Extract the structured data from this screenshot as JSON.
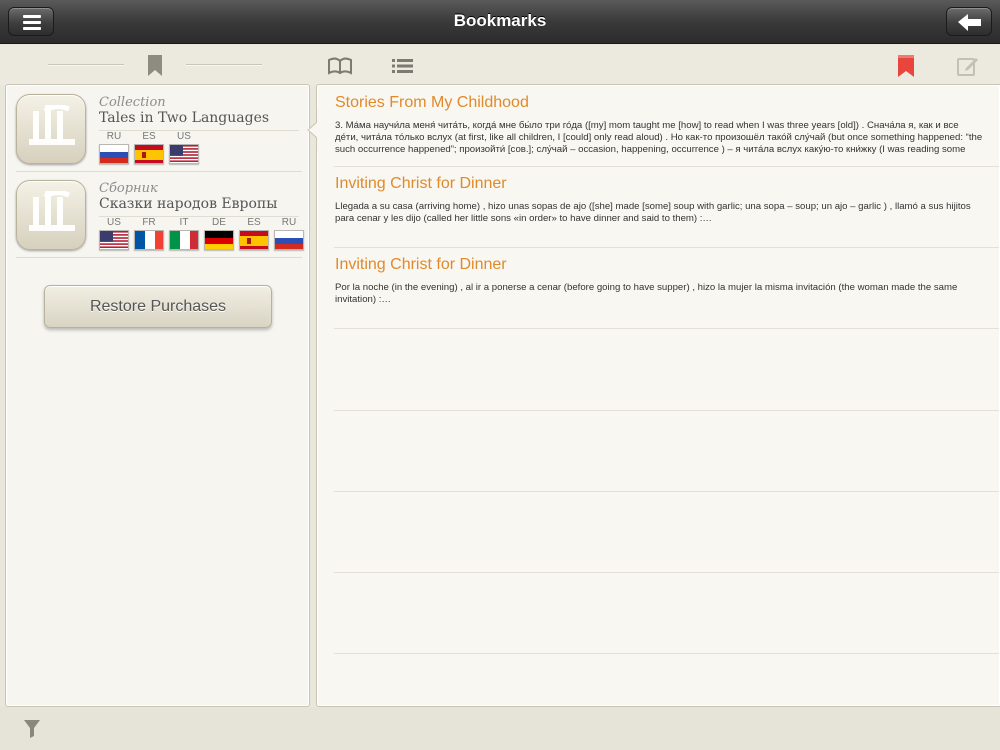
{
  "nav": {
    "title": "Bookmarks",
    "menu_icon": "menu-icon",
    "back_icon": "back-arrow-icon"
  },
  "toolbar": {
    "icons": [
      "bookmark-icon",
      "book-icon",
      "list-icon",
      "red-bookmark-icon",
      "edit-note-icon"
    ],
    "accent_color": "#e8453c"
  },
  "collections": [
    {
      "subtitle": "Collection",
      "title": "Tales in Two Languages",
      "languages": [
        "RU",
        "ES",
        "US"
      ]
    },
    {
      "subtitle": "Сборник",
      "title": "Сказки народов Европы",
      "languages": [
        "US",
        "FR",
        "IT",
        "DE",
        "ES",
        "RU"
      ]
    }
  ],
  "restore_label": "Restore Purchases",
  "bookmarks": [
    {
      "title": "Stories From My Childhood",
      "text": "3. Мáма научи́ла меня́ чита́ть, когда́ мне бы́ло три го́да  ([my] mom taught me [how] to read when I was three years [old]) . Снача́ла я, как и все де́ти, чита́ла то́лько вслух  (at first, like all children, I [could] only read aloud) . Но как-то произошёл тако́й слу́чай  (but once something happened: “the such occurrence happened”;    произойти́ [сов.]; слу́чай – occasion, happening, occurrence )   – я чита́ла вслух каку́ю-то кни́жку  (I was reading some bo…"
    },
    {
      "title": "Inviting Christ for Dinner",
      "text": "Llegada a su casa  (arriving home) , hizo unas sopas de ajo  ([she] made [some] soup with garlic;  una sopa – soup; un ajo – garlic ) , llamó a sus hijitos para cenar y les dijo  (called her little sons «in order» to have dinner and said to them) :…"
    },
    {
      "title": "Inviting Christ for Dinner",
      "text": "Por la noche  (in the evening) , al ir a ponerse a cenar  (before going to have supper) , hizo la mujer la misma invitación  (the woman made the same invitation) :…"
    }
  ],
  "bottom": {
    "filter_icon": "filter-icon"
  },
  "colors": {
    "title_accent": "#e08a2b",
    "nav_bar": "#3a3a3a"
  }
}
